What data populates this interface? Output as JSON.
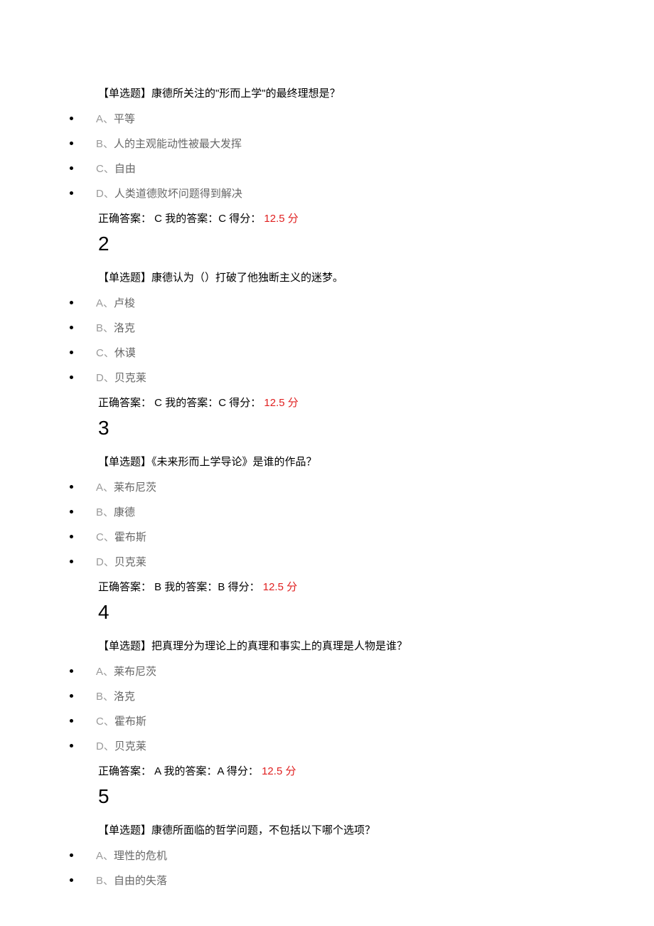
{
  "questions": [
    {
      "number": null,
      "type_label": "【单选题】",
      "text": "康德所关注的\"形而上学\"的最终理想是？",
      "options": [
        {
          "letter": "A、",
          "text": "平等"
        },
        {
          "letter": "B、",
          "text": "人的主观能动性被最大发挥"
        },
        {
          "letter": "C、",
          "text": "自由"
        },
        {
          "letter": "D、",
          "text": "人类道德败坏问题得到解决"
        }
      ],
      "answer": {
        "correct_label": "正确答案：",
        "correct_value": " C ",
        "my_label": "我的答案：",
        "my_value": "C ",
        "score_label": "得分：",
        "score_value": " 12.5 ",
        "score_unit": "分"
      }
    },
    {
      "number": "2",
      "type_label": "【单选题】",
      "text": "康德认为（）打破了他独断主义的迷梦。",
      "options": [
        {
          "letter": "A、",
          "text": "卢梭"
        },
        {
          "letter": "B、",
          "text": "洛克"
        },
        {
          "letter": "C、",
          "text": "休谟"
        },
        {
          "letter": "D、",
          "text": "贝克莱"
        }
      ],
      "answer": {
        "correct_label": "正确答案：",
        "correct_value": " C ",
        "my_label": "我的答案：",
        "my_value": "C ",
        "score_label": "得分：",
        "score_value": " 12.5 ",
        "score_unit": "分"
      }
    },
    {
      "number": "3",
      "type_label": "【单选题】",
      "text": "《未来形而上学导论》是谁的作品？",
      "options": [
        {
          "letter": "A、",
          "text": "莱布尼茨"
        },
        {
          "letter": "B、",
          "text": "康德"
        },
        {
          "letter": "C、",
          "text": "霍布斯"
        },
        {
          "letter": "D、",
          "text": "贝克莱"
        }
      ],
      "answer": {
        "correct_label": "正确答案：",
        "correct_value": " B ",
        "my_label": "我的答案：",
        "my_value": "B ",
        "score_label": "得分：",
        "score_value": " 12.5 ",
        "score_unit": "分"
      }
    },
    {
      "number": "4",
      "type_label": "【单选题】",
      "text": "把真理分为理论上的真理和事实上的真理是人物是谁？",
      "options": [
        {
          "letter": "A、",
          "text": "莱布尼茨"
        },
        {
          "letter": "B、",
          "text": "洛克"
        },
        {
          "letter": "C、",
          "text": "霍布斯"
        },
        {
          "letter": "D、",
          "text": "贝克莱"
        }
      ],
      "answer": {
        "correct_label": "正确答案：",
        "correct_value": " A ",
        "my_label": "我的答案：",
        "my_value": "A ",
        "score_label": "得分：",
        "score_value": " 12.5 ",
        "score_unit": "分"
      }
    },
    {
      "number": "5",
      "type_label": "【单选题】",
      "text": "康德所面临的哲学问题，不包括以下哪个选项？",
      "options": [
        {
          "letter": "A、",
          "text": "理性的危机"
        },
        {
          "letter": "B、",
          "text": "自由的失落"
        }
      ],
      "answer": null
    }
  ]
}
